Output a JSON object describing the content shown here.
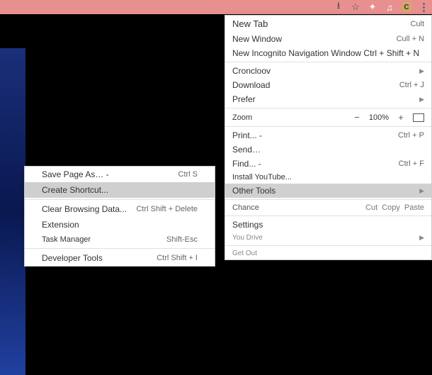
{
  "toolbar": {
    "avatar_letter": "C"
  },
  "main_menu": {
    "new_tab": {
      "label": "New Tab",
      "shortcut": "Cult"
    },
    "new_window": {
      "label": "New Window",
      "shortcut": "Cull + N"
    },
    "incognito": {
      "label": "New Incognito Navigation Window Ctrl + Shift + N"
    },
    "cronology": {
      "label": "Croncloov"
    },
    "download": {
      "label": "Download",
      "shortcut": "Ctrl + J"
    },
    "prefer": {
      "label": "Prefer"
    },
    "zoom": {
      "label": "Zoom",
      "minus": "−",
      "value": "100%",
      "plus": "+"
    },
    "print": {
      "label": "Print... -",
      "shortcut": "Ctrl + P"
    },
    "send": {
      "label": "Send…"
    },
    "find": {
      "label": "Find... -",
      "shortcut": "Ctrl + F"
    },
    "install_yt": {
      "label": "Install YouTube..."
    },
    "other_tools": {
      "label": "Other Tools"
    },
    "change": {
      "label": "Chance"
    },
    "cut": "Cut",
    "copy": "Copy",
    "paste": "Paste",
    "settings": {
      "label": "Settings"
    },
    "you_drive": {
      "label": "You Drive"
    },
    "get_out": {
      "label": "Get Out"
    }
  },
  "sub_menu": {
    "save_as": {
      "label": "Save Page As… -",
      "shortcut": "Ctrl S"
    },
    "create_shortcut": {
      "label": "Create Shortcut..."
    },
    "clear_data": {
      "label": "Clear Browsing Data...",
      "shortcut": "Ctrl Shift + Delete"
    },
    "extension": {
      "label": "Extension"
    },
    "task_mgr": {
      "label": "Task Manager",
      "shortcut": "Shift-Esc"
    },
    "dev_tools": {
      "label": "Developer Tools",
      "shortcut": "Ctrl Shift + I"
    }
  }
}
